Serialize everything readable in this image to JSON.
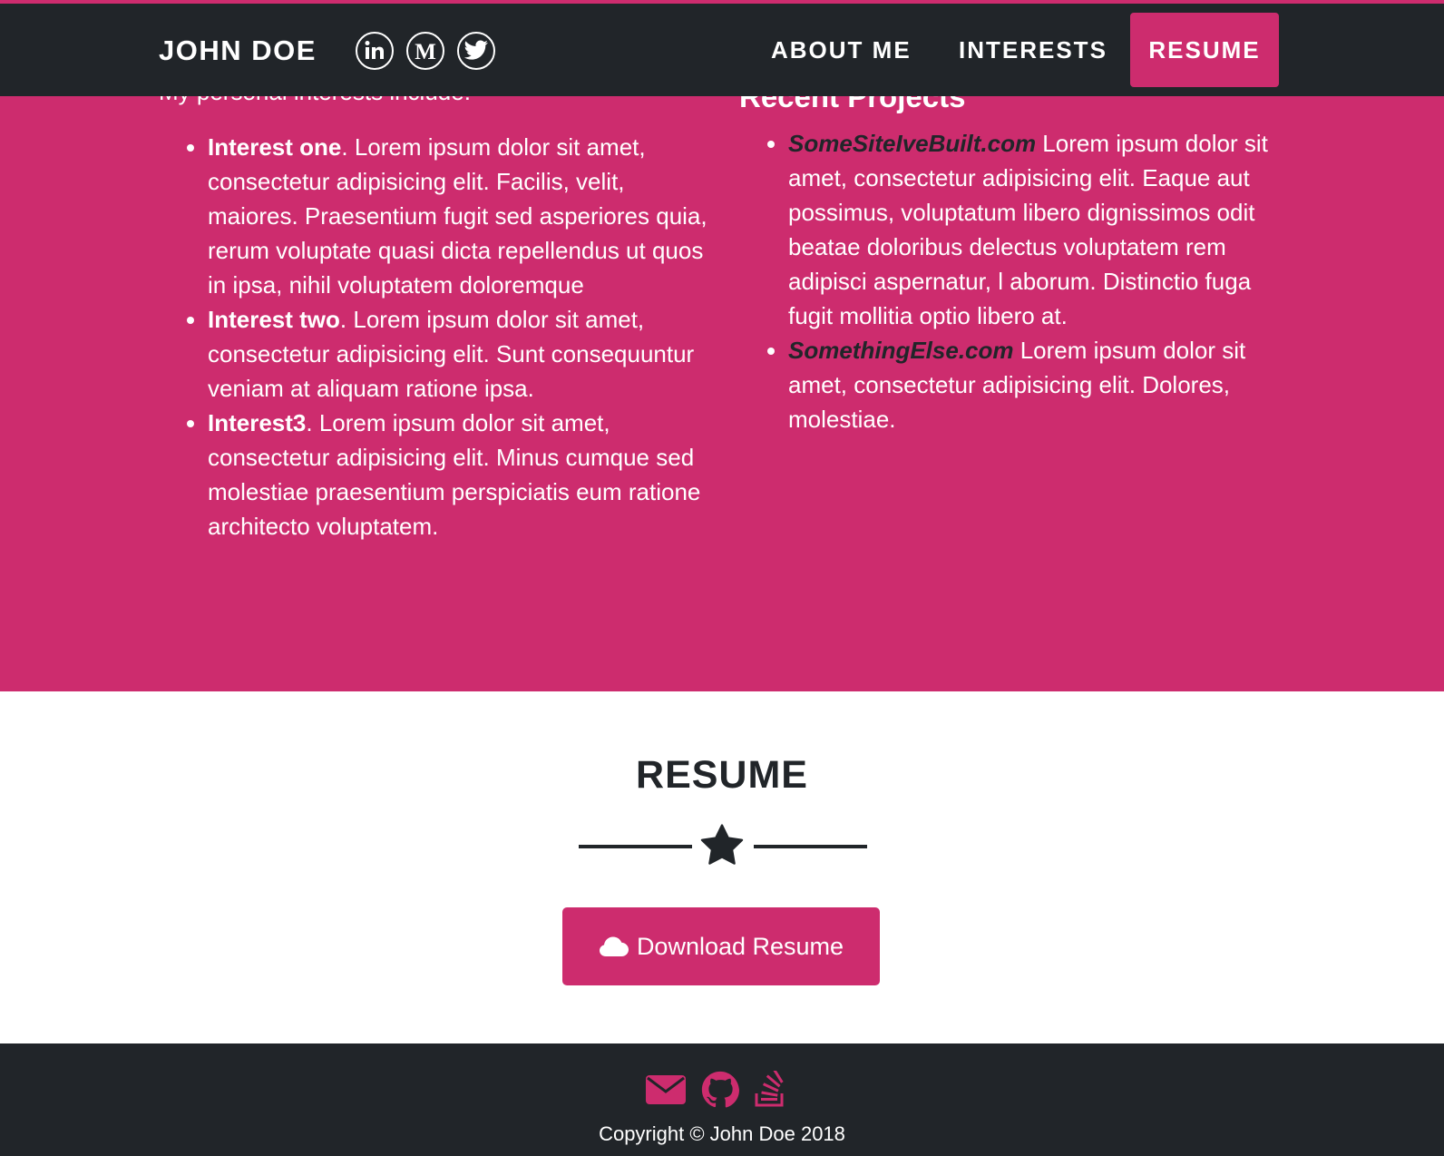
{
  "navbar": {
    "brand": "JOHN DOE",
    "social_icons": [
      "linkedin-icon",
      "medium-icon",
      "twitter-icon"
    ],
    "links": [
      "ABOUT ME",
      "INTERESTS"
    ],
    "active_link": "RESUME"
  },
  "interests": {
    "intro": "My personal interests include:",
    "items": [
      {
        "title": "Interest one",
        "text": ". Lorem ipsum dolor sit amet, consectetur adipisicing elit. Facilis, velit, maiores. Praesentium fugit sed asperiores quia, rerum voluptate quasi dicta repellendus ut quos in ipsa, nihil voluptatem doloremque"
      },
      {
        "title": "Interest two",
        "text": ". Lorem ipsum dolor sit amet, consectetur adipisicing elit. Sunt consequuntur veniam at aliquam ratione ipsa."
      },
      {
        "title": "Interest3",
        "text": ". Lorem ipsum dolor sit amet, consectetur adipisicing elit. Minus cumque sed molestiae praesentium perspiciatis eum ratione architecto voluptatem."
      }
    ]
  },
  "projects": {
    "heading": "Recent Projects",
    "items": [
      {
        "link": "SomeSiteIveBuilt.com",
        "text": " Lorem ipsum dolor sit amet, consectetur adipisicing elit. Eaque aut possimus, voluptatum libero dignissimos odit beatae doloribus delectus voluptatem rem adipisci aspernatur, l aborum. Distinctio fuga fugit mollitia optio libero at."
      },
      {
        "link": "SomethingElse.com",
        "text": " Lorem ipsum dolor sit amet, consectetur adipisicing elit. Dolores, molestiae."
      }
    ]
  },
  "resume": {
    "title": "RESUME",
    "divider_icon": "star-icon",
    "download_label": "Download Resume",
    "download_icon": "cloud-icon"
  },
  "footer": {
    "icons": [
      "envelope-icon",
      "github-icon",
      "stack-overflow-icon"
    ],
    "copyright": "Copyright © John Doe 2018"
  },
  "colors": {
    "accent": "#cd2c6e",
    "dark": "#212529",
    "white": "#ffffff"
  }
}
